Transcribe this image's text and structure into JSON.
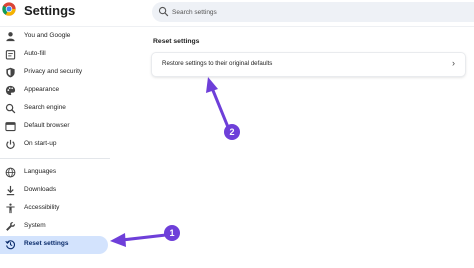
{
  "header": {
    "app_title": "Settings",
    "search_placeholder": "Search settings"
  },
  "sidebar": {
    "items": [
      {
        "label": "You and Google",
        "icon": "person-icon"
      },
      {
        "label": "Auto-fill",
        "icon": "clipboard-icon"
      },
      {
        "label": "Privacy and security",
        "icon": "shield-icon"
      },
      {
        "label": "Appearance",
        "icon": "palette-icon"
      },
      {
        "label": "Search engine",
        "icon": "search-icon"
      },
      {
        "label": "Default browser",
        "icon": "browser-icon"
      },
      {
        "label": "On start-up",
        "icon": "power-icon"
      },
      {
        "label": "Languages",
        "icon": "globe-icon"
      },
      {
        "label": "Downloads",
        "icon": "download-icon"
      },
      {
        "label": "Accessibility",
        "icon": "accessibility-icon"
      },
      {
        "label": "System",
        "icon": "wrench-icon"
      },
      {
        "label": "Reset settings",
        "icon": "history-icon",
        "active": true
      }
    ]
  },
  "main": {
    "section_title": "Reset settings",
    "restore_label": "Restore settings to their original defaults"
  },
  "annotations": {
    "badge_1": "1",
    "badge_2": "2"
  },
  "colors": {
    "accent": "#d3e3fd",
    "annotation": "#6e3fd9"
  }
}
